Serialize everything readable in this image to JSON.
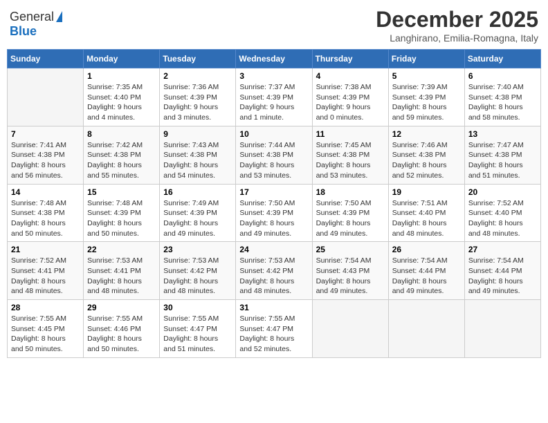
{
  "logo": {
    "general": "General",
    "blue": "Blue"
  },
  "title": "December 2025",
  "location": "Langhirano, Emilia-Romagna, Italy",
  "days_of_week": [
    "Sunday",
    "Monday",
    "Tuesday",
    "Wednesday",
    "Thursday",
    "Friday",
    "Saturday"
  ],
  "weeks": [
    [
      {
        "day": "",
        "info": ""
      },
      {
        "day": "1",
        "info": "Sunrise: 7:35 AM\nSunset: 4:40 PM\nDaylight: 9 hours\nand 4 minutes."
      },
      {
        "day": "2",
        "info": "Sunrise: 7:36 AM\nSunset: 4:39 PM\nDaylight: 9 hours\nand 3 minutes."
      },
      {
        "day": "3",
        "info": "Sunrise: 7:37 AM\nSunset: 4:39 PM\nDaylight: 9 hours\nand 1 minute."
      },
      {
        "day": "4",
        "info": "Sunrise: 7:38 AM\nSunset: 4:39 PM\nDaylight: 9 hours\nand 0 minutes."
      },
      {
        "day": "5",
        "info": "Sunrise: 7:39 AM\nSunset: 4:39 PM\nDaylight: 8 hours\nand 59 minutes."
      },
      {
        "day": "6",
        "info": "Sunrise: 7:40 AM\nSunset: 4:38 PM\nDaylight: 8 hours\nand 58 minutes."
      }
    ],
    [
      {
        "day": "7",
        "info": "Sunrise: 7:41 AM\nSunset: 4:38 PM\nDaylight: 8 hours\nand 56 minutes."
      },
      {
        "day": "8",
        "info": "Sunrise: 7:42 AM\nSunset: 4:38 PM\nDaylight: 8 hours\nand 55 minutes."
      },
      {
        "day": "9",
        "info": "Sunrise: 7:43 AM\nSunset: 4:38 PM\nDaylight: 8 hours\nand 54 minutes."
      },
      {
        "day": "10",
        "info": "Sunrise: 7:44 AM\nSunset: 4:38 PM\nDaylight: 8 hours\nand 53 minutes."
      },
      {
        "day": "11",
        "info": "Sunrise: 7:45 AM\nSunset: 4:38 PM\nDaylight: 8 hours\nand 53 minutes."
      },
      {
        "day": "12",
        "info": "Sunrise: 7:46 AM\nSunset: 4:38 PM\nDaylight: 8 hours\nand 52 minutes."
      },
      {
        "day": "13",
        "info": "Sunrise: 7:47 AM\nSunset: 4:38 PM\nDaylight: 8 hours\nand 51 minutes."
      }
    ],
    [
      {
        "day": "14",
        "info": "Sunrise: 7:48 AM\nSunset: 4:38 PM\nDaylight: 8 hours\nand 50 minutes."
      },
      {
        "day": "15",
        "info": "Sunrise: 7:48 AM\nSunset: 4:39 PM\nDaylight: 8 hours\nand 50 minutes."
      },
      {
        "day": "16",
        "info": "Sunrise: 7:49 AM\nSunset: 4:39 PM\nDaylight: 8 hours\nand 49 minutes."
      },
      {
        "day": "17",
        "info": "Sunrise: 7:50 AM\nSunset: 4:39 PM\nDaylight: 8 hours\nand 49 minutes."
      },
      {
        "day": "18",
        "info": "Sunrise: 7:50 AM\nSunset: 4:39 PM\nDaylight: 8 hours\nand 49 minutes."
      },
      {
        "day": "19",
        "info": "Sunrise: 7:51 AM\nSunset: 4:40 PM\nDaylight: 8 hours\nand 48 minutes."
      },
      {
        "day": "20",
        "info": "Sunrise: 7:52 AM\nSunset: 4:40 PM\nDaylight: 8 hours\nand 48 minutes."
      }
    ],
    [
      {
        "day": "21",
        "info": "Sunrise: 7:52 AM\nSunset: 4:41 PM\nDaylight: 8 hours\nand 48 minutes."
      },
      {
        "day": "22",
        "info": "Sunrise: 7:53 AM\nSunset: 4:41 PM\nDaylight: 8 hours\nand 48 minutes."
      },
      {
        "day": "23",
        "info": "Sunrise: 7:53 AM\nSunset: 4:42 PM\nDaylight: 8 hours\nand 48 minutes."
      },
      {
        "day": "24",
        "info": "Sunrise: 7:53 AM\nSunset: 4:42 PM\nDaylight: 8 hours\nand 48 minutes."
      },
      {
        "day": "25",
        "info": "Sunrise: 7:54 AM\nSunset: 4:43 PM\nDaylight: 8 hours\nand 49 minutes."
      },
      {
        "day": "26",
        "info": "Sunrise: 7:54 AM\nSunset: 4:44 PM\nDaylight: 8 hours\nand 49 minutes."
      },
      {
        "day": "27",
        "info": "Sunrise: 7:54 AM\nSunset: 4:44 PM\nDaylight: 8 hours\nand 49 minutes."
      }
    ],
    [
      {
        "day": "28",
        "info": "Sunrise: 7:55 AM\nSunset: 4:45 PM\nDaylight: 8 hours\nand 50 minutes."
      },
      {
        "day": "29",
        "info": "Sunrise: 7:55 AM\nSunset: 4:46 PM\nDaylight: 8 hours\nand 50 minutes."
      },
      {
        "day": "30",
        "info": "Sunrise: 7:55 AM\nSunset: 4:47 PM\nDaylight: 8 hours\nand 51 minutes."
      },
      {
        "day": "31",
        "info": "Sunrise: 7:55 AM\nSunset: 4:47 PM\nDaylight: 8 hours\nand 52 minutes."
      },
      {
        "day": "",
        "info": ""
      },
      {
        "day": "",
        "info": ""
      },
      {
        "day": "",
        "info": ""
      }
    ]
  ]
}
